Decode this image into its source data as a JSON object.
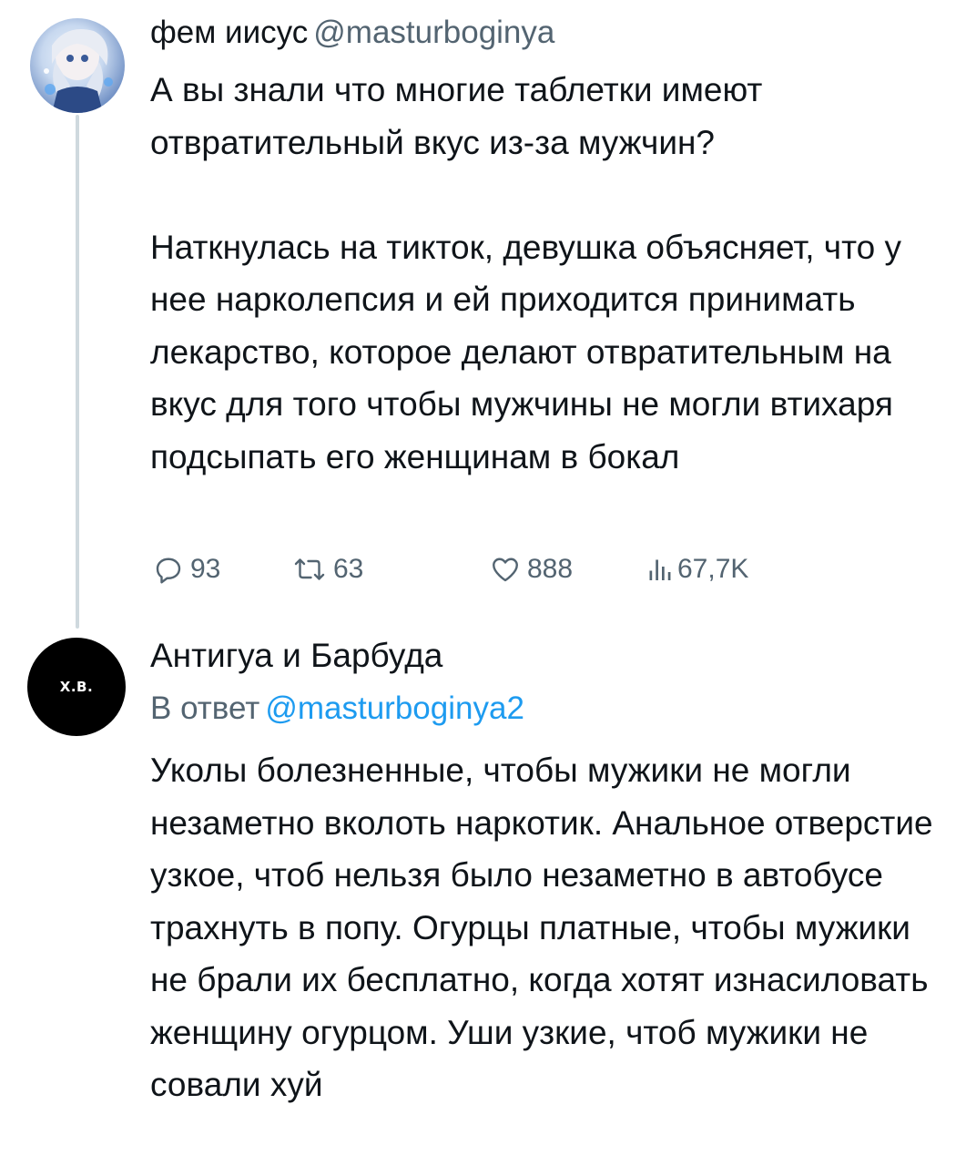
{
  "tweet1": {
    "author_name": "фем иисус",
    "author_handle": "@masturboginya",
    "paragraph1": "А вы знали что многие таблетки имеют отвратительный вкус из-за мужчин?",
    "paragraph2": "Наткнулась на тикток, девушка объясняет, что у нее нарколепсия и ей приходится принимать лекарство, которое делают отвратительным на вкус для того чтобы мужчины не могли втихаря подсыпать его женщинам в бокал",
    "stats": {
      "replies": "93",
      "retweets": "63",
      "likes": "888",
      "views": "67,7K"
    }
  },
  "tweet2": {
    "avatar_text": "Х.В.",
    "author_name": "Антигуа и Барбуда",
    "reply_prefix": "В ответ",
    "reply_mention": "@masturboginya2",
    "text": "Уколы болезненные, чтобы мужики не могли незаметно вколоть наркотик. Анальное отверстие узкое, чтоб нельзя было незаметно в автобусе трахнуть в попу. Огурцы платные, чтобы мужики не брали их бесплатно, когда хотят изнасиловать женщину огурцом. Уши узкие, чтоб мужики не совали хуй"
  },
  "icons": {
    "reply": "reply-icon",
    "retweet": "retweet-icon",
    "like": "heart-icon",
    "views": "views-icon"
  },
  "colors": {
    "text_primary": "#0f1419",
    "text_secondary": "#536471",
    "link": "#1d9bf0",
    "thread_line": "#cfd9de"
  }
}
